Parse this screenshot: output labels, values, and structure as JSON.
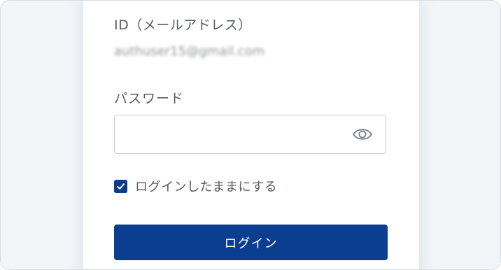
{
  "form": {
    "id_label": "ID（メールアドレス）",
    "id_value": "authuser15@gmail.com",
    "password_label": "パスワード",
    "password_value": "",
    "show_password_icon": "eye-icon",
    "remember_me": {
      "label": "ログインしたままにする",
      "checked": true
    },
    "login_button_label": "ログイン"
  },
  "colors": {
    "primary": "#0b3d91",
    "background": "#f2f6f9",
    "label_text": "#555c63",
    "input_border": "#c9cdd2"
  }
}
